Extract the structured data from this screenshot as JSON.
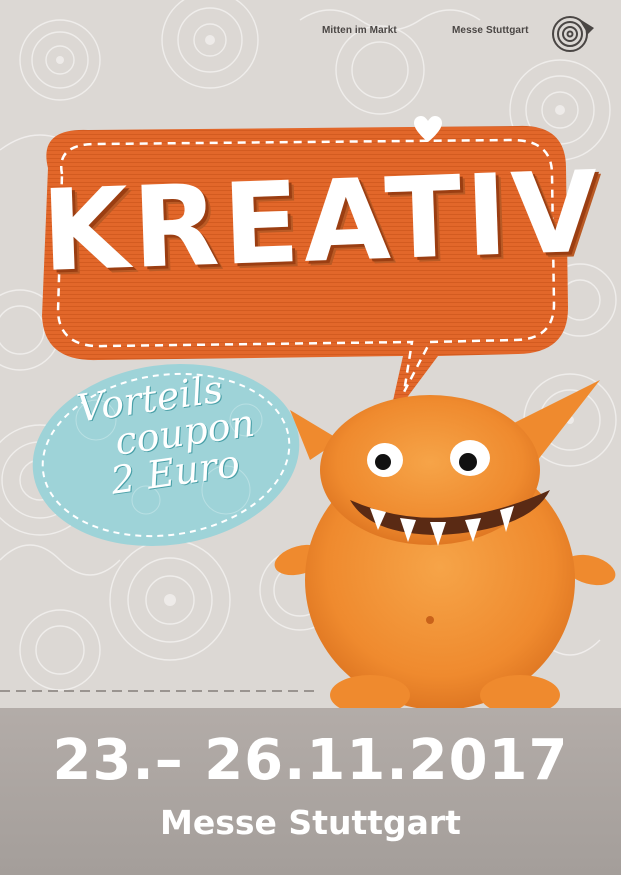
{
  "header": {
    "tagline": "Mitten im Markt",
    "brand": "Messe Stuttgart"
  },
  "logo": {
    "icon": "swirl-logo-icon"
  },
  "headline": {
    "title": "KREATIV",
    "accent_icon": "heart-icon"
  },
  "coupon": {
    "line1": "Vorteils",
    "line2": "coupon",
    "line3": "2 Euro"
  },
  "event": {
    "dates": "23.– 26.11.2017",
    "venue": "Messe Stuttgart"
  },
  "colors": {
    "bubble_orange": "#e2672a",
    "coupon_blue": "#9ed3d8",
    "band_gray": "#aaa4a0",
    "background": "#dcd8d4",
    "monster_orange": "#ef8a2e"
  }
}
